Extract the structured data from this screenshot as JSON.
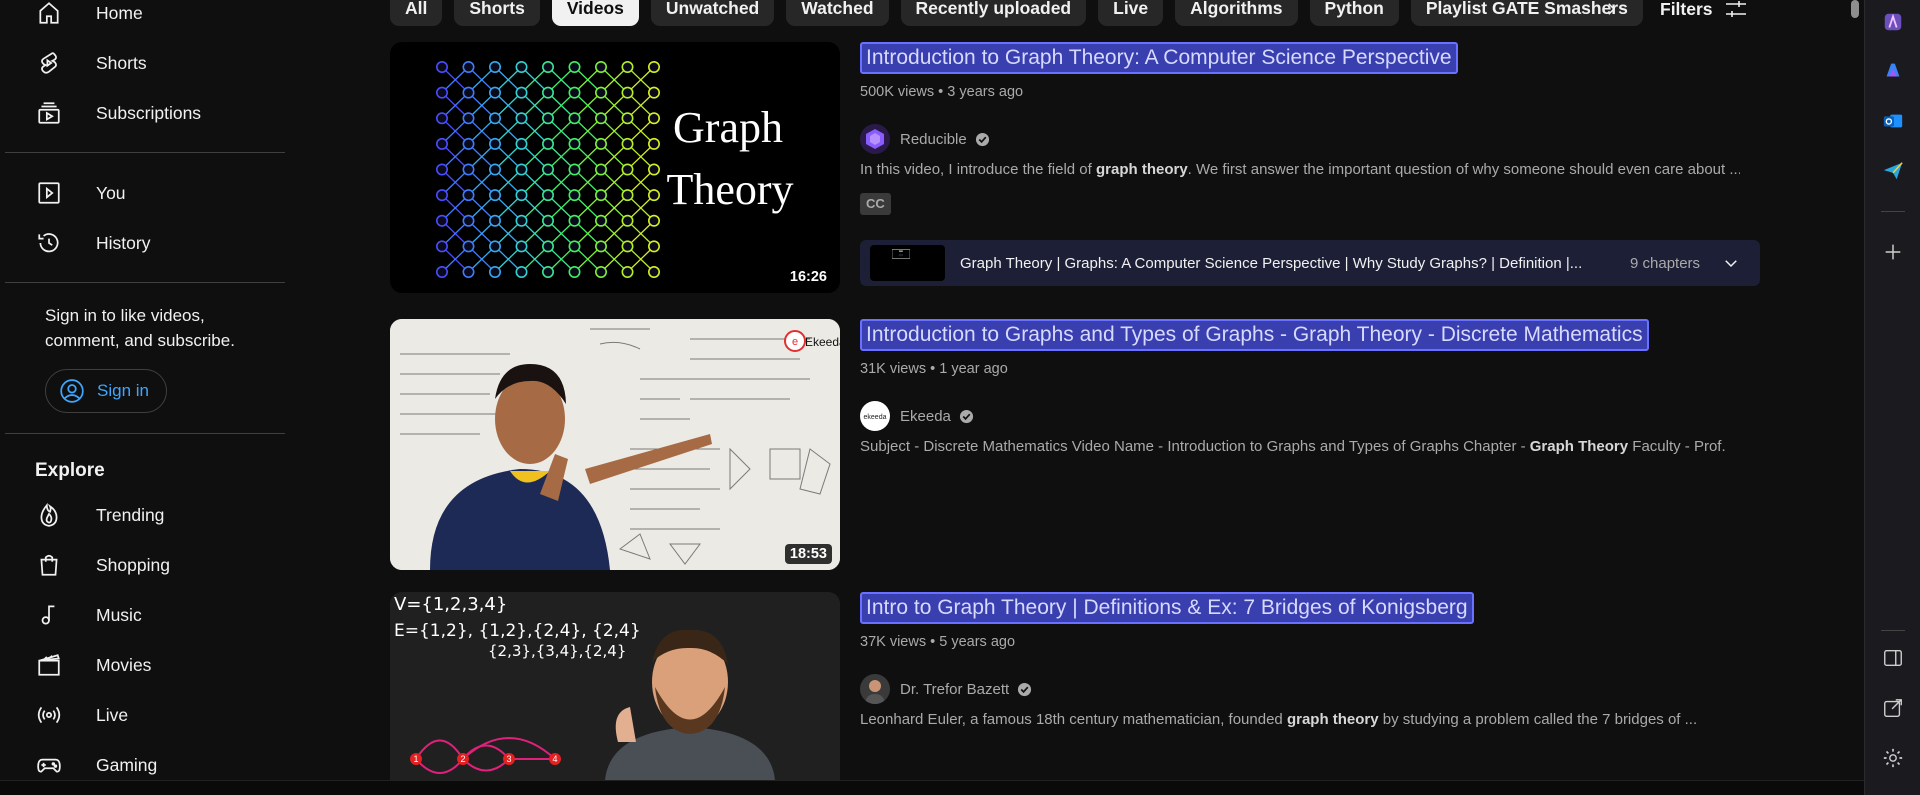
{
  "sidebar": {
    "items_top": [
      {
        "label": "Home",
        "icon": "home-icon"
      },
      {
        "label": "Shorts",
        "icon": "shorts-icon"
      },
      {
        "label": "Subscriptions",
        "icon": "subscriptions-icon"
      }
    ],
    "items_you": [
      {
        "label": "You",
        "icon": "you-icon"
      },
      {
        "label": "History",
        "icon": "history-icon"
      }
    ],
    "signin_prompt": "Sign in to like videos, comment, and subscribe.",
    "signin_label": "Sign in",
    "explore_title": "Explore",
    "explore_items": [
      {
        "label": "Trending",
        "icon": "trending-icon"
      },
      {
        "label": "Shopping",
        "icon": "shopping-icon"
      },
      {
        "label": "Music",
        "icon": "music-icon"
      },
      {
        "label": "Movies",
        "icon": "movies-icon"
      },
      {
        "label": "Live",
        "icon": "live-icon"
      },
      {
        "label": "Gaming",
        "icon": "gaming-icon"
      }
    ]
  },
  "chips": [
    "All",
    "Shorts",
    "Videos",
    "Unwatched",
    "Watched",
    "Recently uploaded",
    "Live",
    "Algorithms",
    "Python",
    "Playlist GATE Smashers"
  ],
  "active_chip": "Videos",
  "filters_label": "Filters",
  "results": [
    {
      "title": "Introduction to Graph Theory: A Computer Science Perspective",
      "views": "500K views",
      "age": "3 years ago",
      "channel": "Reducible",
      "desc_pre": "In this video, I introduce the field of ",
      "desc_bold": "graph theory",
      "desc_post": ". We first answer the important question of why someone should even care about ...",
      "badge": "CC",
      "duration": "16:26",
      "thumb_text_1": "Graph",
      "thumb_text_2": "Theory",
      "chapters_title": "Graph Theory | Graphs: A Computer Science Perspective | Why Study Graphs? | Definition |...",
      "chapters_count": "9 chapters"
    },
    {
      "title": "Introduction to Graphs and Types of Graphs - Graph Theory - Discrete Mathematics",
      "views": "31K views",
      "age": "1 year ago",
      "channel": "Ekeeda",
      "desc_pre": "Subject - Discrete Mathematics Video Name - Introduction to Graphs and Types of Graphs Chapter - ",
      "desc_bold": "Graph Theory",
      "desc_post": " Faculty - Prof.",
      "duration": "18:53",
      "thumb_brand": "Ekeeda"
    },
    {
      "title": "Intro to Graph Theory | Definitions & Ex: 7 Bridges of Konigsberg",
      "views": "37K views",
      "age": "5 years ago",
      "channel": "Dr. Trefor Bazett",
      "desc_pre": "Leonhard Euler, a famous 18th century mathematician, founded ",
      "desc_bold": "graph theory",
      "desc_post": " by studying a problem called the 7 bridges of ...",
      "thumb_v": "V={1,2,3,4}",
      "thumb_e1": "E={1,2}, {1,2},{2,4}, {2,4}",
      "thumb_e2": "{2,3},{3,4},{2,4}",
      "thumb_nodes": [
        "1",
        "2",
        "3",
        "4"
      ]
    }
  ],
  "colors": {
    "background": "#0f0f0f",
    "chip": "#272727",
    "chip_active": "#f1f1f1",
    "link_blue": "#3ea6ff",
    "selection": "#3a3fb0"
  }
}
